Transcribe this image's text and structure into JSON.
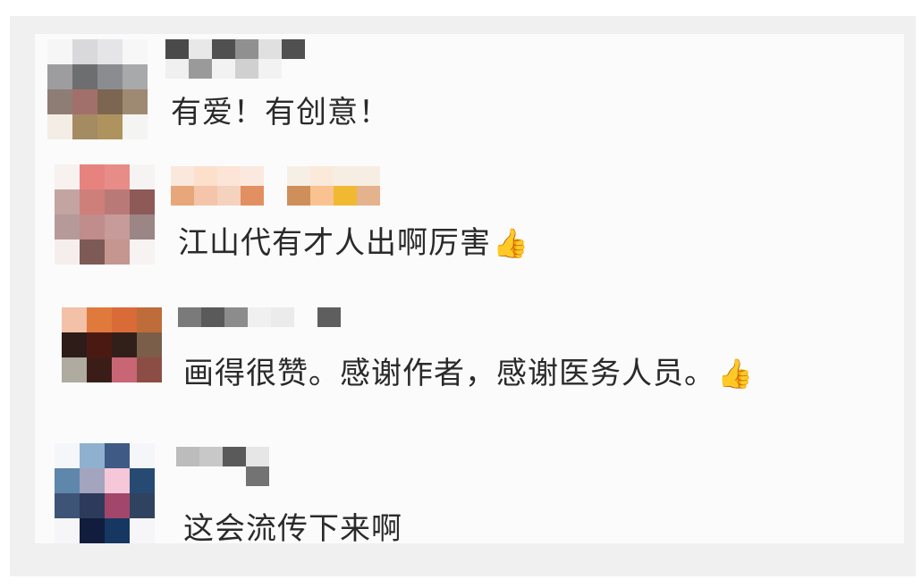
{
  "comments": [
    {
      "text": "有爱！有创意！",
      "emoji": "",
      "avatar_colors": [
        "#f6f6f6",
        "#d9d9db",
        "#e5e5e8",
        "#f7f7f7",
        "#9d9d9f",
        "#6d6e70",
        "#8b8c8f",
        "#a8a9ab",
        "#8e7d74",
        "#a2706b",
        "#7c6651",
        "#9e8a73",
        "#f3ede6",
        "#a58b62",
        "#ae935e",
        "#f4f4f2"
      ],
      "name_colors": [
        "#4a4a4a",
        "#f0f0f0",
        "#e8e8e8",
        "#9a9a9a",
        "#505050",
        "#f2f2f2",
        "#909090",
        "#d0d0d0",
        "#e0e0e0",
        "#f2f2f2",
        "#505050",
        "#fbfbfb"
      ]
    },
    {
      "text": "江山代有才人出啊厉害",
      "emoji": "👍",
      "avatar_colors": [
        "#f7f1f0",
        "#e7837f",
        "#e88c88",
        "#f6f4f3",
        "#c4a4a0",
        "#cf7f7a",
        "#b97a77",
        "#8e5a58",
        "#b69a9a",
        "#c08c8c",
        "#c69b99",
        "#9b8585",
        "#f6eeec",
        "#7e5a56",
        "#c59590",
        "#f7f3f2"
      ],
      "name_colors": [
        "#fbe8dc",
        "#e8a77a",
        "#fde0cc",
        "#f4c5aa",
        "#fce5d6",
        "#f5d2bd",
        "#fbe9df",
        "#e28f62",
        "#fbfbfb",
        "#fbfbfb",
        "#f6efe6",
        "#cf8f5a",
        "#fbe9da",
        "#f8c390",
        "#f6eee2",
        "#f1b931",
        "#f6eee2",
        "#e4b28d"
      ]
    },
    {
      "text": "画得很赞。感谢作者，感谢医务人员。",
      "emoji": "👍",
      "avatar_colors": [
        "#f3c0a8",
        "#e07a3c",
        "#d96b38",
        "#bd6c3a",
        "#2d1c18",
        "#4a1a12",
        "#31201a",
        "#7a5e49",
        "#b0aba0",
        "#3b1d18",
        "#c86676",
        "#8c4e44",
        "#fbfbfb",
        "#fbfbfb",
        "#fbfbfb",
        "#fbfbfb"
      ],
      "name_colors": [
        "#7a7a7a",
        "#fbfbfb",
        "#5a5a5a",
        "#fbfbfb",
        "#8c8c8c",
        "#fbfbfb",
        "#f0f0f0",
        "#fbfbfb",
        "#ebebeb",
        "#fbfbfb",
        "#fbfbfb",
        "#fbfbfb",
        "#5e5e5e",
        "#fbfbfb"
      ]
    },
    {
      "text": "这会流传下来啊",
      "emoji": "",
      "avatar_colors": [
        "#f4f6fa",
        "#8fb1cf",
        "#3e5a85",
        "#f4f6fa",
        "#5f86ab",
        "#a3a4bd",
        "#f5c7d8",
        "#274a72",
        "#3e5477",
        "#2e3a5b",
        "#a3466b",
        "#2f4260",
        "#f6f6f8",
        "#121d3d",
        "#163761",
        "#f6f6f8"
      ],
      "name_colors": [
        "#bcbcbc",
        "#fbfbfb",
        "#c8c8c8",
        "#fbfbfb",
        "#5a5a5a",
        "#fbfbfb",
        "#e6e6e6",
        "#737373"
      ]
    }
  ]
}
